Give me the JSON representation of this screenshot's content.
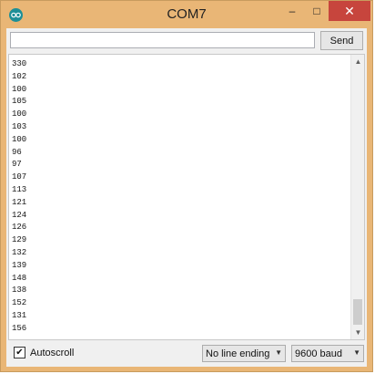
{
  "window": {
    "title": "COM7",
    "icon": "arduino-icon",
    "min_glyph": "–",
    "max_glyph": "□",
    "close_glyph": "✕"
  },
  "toolbar": {
    "input_value": "",
    "send_label": "Send"
  },
  "output": {
    "lines": [
      "330",
      "102",
      "100",
      "105",
      "100",
      "103",
      "100",
      "96",
      "97",
      "107",
      "113",
      "121",
      "124",
      "126",
      "129",
      "132",
      "139",
      "148",
      "138",
      "152",
      "131",
      "156"
    ],
    "scroll_up_glyph": "▲",
    "scroll_down_glyph": "▼"
  },
  "footer": {
    "autoscroll_label": "Autoscroll",
    "autoscroll_checked": true,
    "line_ending": "No line ending",
    "baud_rate": "9600 baud"
  },
  "colors": {
    "frame": "#e9b676",
    "close": "#c7453d",
    "app_icon": "#1d8f97"
  }
}
